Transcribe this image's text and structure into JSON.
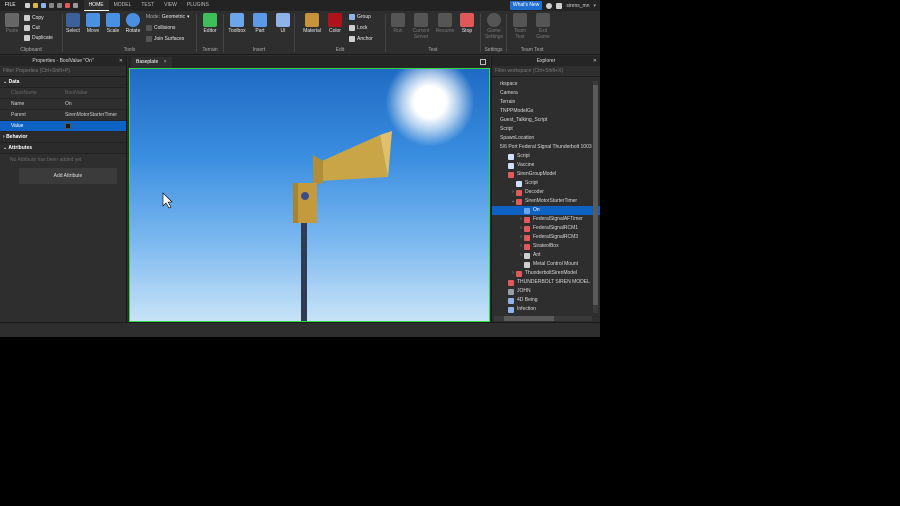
{
  "menubar": {
    "file": "FILE",
    "tabs": [
      "HOME",
      "MODEL",
      "TEST",
      "VIEW",
      "PLUGINS"
    ],
    "whats_new": "What's New",
    "user": "sirens_mn"
  },
  "ribbon": {
    "clipboard": {
      "paste": "Paste",
      "copy": "Copy",
      "cut": "Cut",
      "duplicate": "Duplicate",
      "label": "Clipboard"
    },
    "tools": {
      "select": "Select",
      "move": "Move",
      "scale": "Scale",
      "rotate": "Rotate",
      "mode_label": "Mode:",
      "mode_value": "Geometric",
      "collisions": "Collisions",
      "join_surfaces": "Join Surfaces",
      "label": "Tools"
    },
    "terrain": {
      "editor": "Editor",
      "label": "Terrain"
    },
    "insert": {
      "toolbox": "Toolbox",
      "part": "Part",
      "ui": "UI",
      "label": "Insert"
    },
    "edit": {
      "material": "Material",
      "color": "Color",
      "group": "Group",
      "lock": "Lock",
      "anchor": "Anchor",
      "label": "Edit"
    },
    "test": {
      "run": "Run",
      "current_server": "Current Server",
      "resume": "Resume",
      "stop": "Stop",
      "label": "Test"
    },
    "settings": {
      "game_settings": "Game Settings",
      "label": "Settings"
    },
    "team_test": {
      "team_test": "Team Test",
      "exit_game": "Exit Game",
      "label": "Team Test"
    }
  },
  "properties": {
    "title": "Properties - BoolValue \"On\"",
    "filter_placeholder": "Filter Properties (Ctrl+Shift+P)",
    "data_section": "Data",
    "rows": [
      {
        "key": "ClassName",
        "value": "BoolValue"
      },
      {
        "key": "Name",
        "value": "On"
      },
      {
        "key": "Parent",
        "value": "SirenMotorStarterTimer"
      },
      {
        "key": "Value",
        "value": ""
      }
    ],
    "behavior_section": "Behavior",
    "attributes_section": "Attributes",
    "no_attributes": "No Attribute has been added yet",
    "add_attribute": "Add Attribute"
  },
  "viewport": {
    "tab_label": "Baseplate",
    "tab_close": "×"
  },
  "explorer": {
    "title": "Explorer",
    "filter_placeholder": "Filter workspace (Ctrl+Shift+X)",
    "items": [
      {
        "label": "rkspace",
        "icon": "",
        "indent": 0
      },
      {
        "label": "Camera",
        "icon": "",
        "indent": 0
      },
      {
        "label": "Terrain",
        "icon": "",
        "indent": 0
      },
      {
        "label": "TNPPModelGs",
        "icon": "",
        "indent": 0
      },
      {
        "label": "Guest_Talking_Script",
        "icon": "",
        "indent": 0
      },
      {
        "label": "Script",
        "icon": "",
        "indent": 0
      },
      {
        "label": "SpawnLocation",
        "icon": "",
        "indent": 0
      },
      {
        "label": "5/6 Port Federal Signal Thunderbolt 1003",
        "icon": "",
        "indent": 0
      },
      {
        "label": "Script",
        "icon": "script",
        "indent": 1
      },
      {
        "label": "Vaccine",
        "icon": "script",
        "indent": 1
      },
      {
        "label": "SirenGroupModel",
        "icon": "model",
        "indent": 1
      },
      {
        "label": "Script",
        "icon": "script",
        "indent": 2
      },
      {
        "label": "Decoder",
        "icon": "model",
        "indent": 2,
        "arrow": "›"
      },
      {
        "label": "SirenMotorStarterTimer",
        "icon": "model",
        "indent": 2,
        "arrow": "⌄"
      },
      {
        "label": "On",
        "icon": "bool",
        "indent": 3,
        "selected": true
      },
      {
        "label": "FederalSignalAFTimer",
        "icon": "model",
        "indent": 3,
        "arrow": "›"
      },
      {
        "label": "FederalSignalRCM1",
        "icon": "model",
        "indent": 3,
        "arrow": "›"
      },
      {
        "label": "FederalSignalRCM3",
        "icon": "model",
        "indent": 3,
        "arrow": "›"
      },
      {
        "label": "SirateolBox",
        "icon": "model",
        "indent": 3,
        "arrow": "›"
      },
      {
        "label": "Ant",
        "icon": "mesh",
        "indent": 3,
        "arrow": "›"
      },
      {
        "label": "Metal Control Mount",
        "icon": "mesh",
        "indent": 3
      },
      {
        "label": "ThunderboltSirenModel",
        "icon": "model",
        "indent": 2,
        "arrow": "›"
      },
      {
        "label": "THUNDERBOLT SIREN MODEL",
        "icon": "model",
        "indent": 1
      },
      {
        "label": "JOHN",
        "icon": "folder",
        "indent": 1
      },
      {
        "label": "4D Being",
        "icon": "part",
        "indent": 1
      },
      {
        "label": "Infection",
        "icon": "part",
        "indent": 1
      }
    ]
  },
  "colors": {
    "accent": "#0e62c4",
    "viewport_border": "#32d74b",
    "stop": "#e05858",
    "whats_new": "#1e6fd0"
  }
}
